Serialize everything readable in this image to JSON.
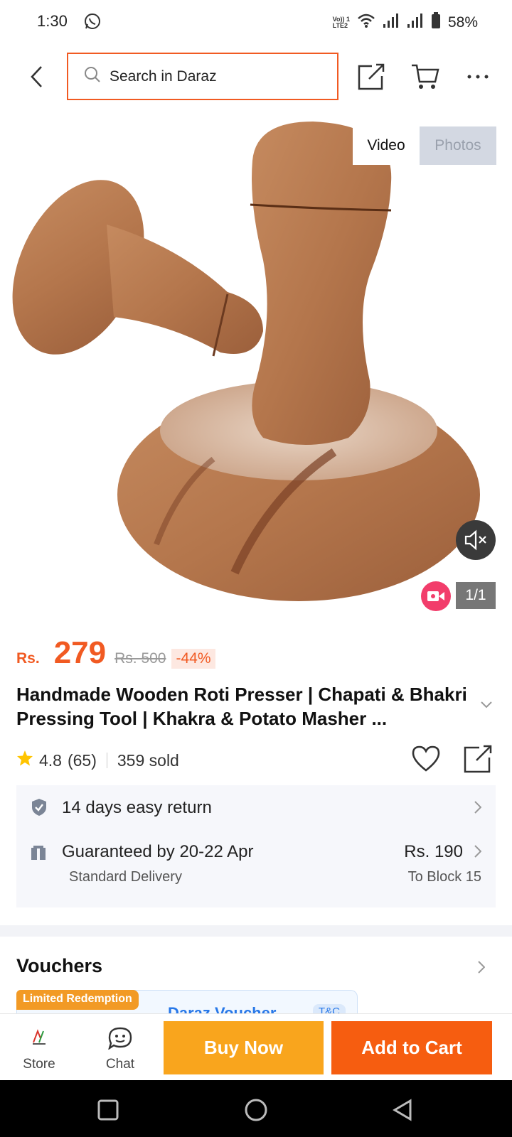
{
  "status_bar": {
    "time": "1:30",
    "lte_label_top": "Vo)) 1",
    "lte_label_bottom": "LTE2",
    "battery": "58%"
  },
  "top_bar": {
    "search_placeholder": "Search in Daraz",
    "icons": [
      "back-icon",
      "share-icon",
      "cart-icon",
      "more-icon"
    ]
  },
  "gallery": {
    "tab_video": "Video",
    "tab_photos": "Photos",
    "counter": "1/1",
    "icons": [
      "mute-icon",
      "video-badge-icon"
    ]
  },
  "product": {
    "currency": "Rs.",
    "price": "279",
    "original_price": "Rs. 500",
    "discount": "-44%",
    "title": "Handmade Wooden Roti Presser | Chapati & Bhakri Pressing Tool | Khakra & Potato Masher ...",
    "rating": "4.8",
    "rating_count": "(65)",
    "sold": "359 sold"
  },
  "services": {
    "return": "14 days easy return",
    "delivery": "Guaranteed by 20-22 Apr",
    "delivery_type": "Standard Delivery",
    "delivery_price": "Rs. 190",
    "delivery_destination": "To Block 15"
  },
  "vouchers": {
    "title": "Vouchers",
    "badge": "Limited Redemption",
    "card_name": "Daraz Voucher",
    "card_tc": "T&C"
  },
  "action_bar": {
    "store_label": "Store",
    "chat_label": "Chat",
    "buy_now": "Buy Now",
    "add_to_cart": "Add to Cart"
  },
  "colors": {
    "brand_orange": "#f15a22",
    "buy_now_bg": "#f9a51d",
    "add_to_cart_bg": "#f65d10",
    "voucher_blue": "#2878e8"
  }
}
